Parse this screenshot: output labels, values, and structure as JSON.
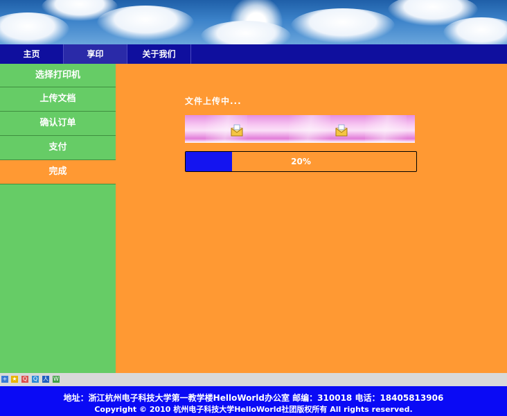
{
  "nav": {
    "items": [
      {
        "label": "主页"
      },
      {
        "label": "享印"
      },
      {
        "label": "关于我们"
      }
    ]
  },
  "sidebar": {
    "items": [
      {
        "label": "选择打印机"
      },
      {
        "label": "上传文档"
      },
      {
        "label": "确认订单"
      },
      {
        "label": "支付"
      },
      {
        "label": "完成"
      }
    ]
  },
  "main": {
    "upload_title": "文件上传中...",
    "progress": {
      "value": 0.2,
      "label": "20%"
    }
  },
  "footer": {
    "line1": "地址：浙江杭州电子科技大学第一教学楼HelloWorld办公室 邮编：310018 电话：18405813906",
    "line2": "Copyright © 2010 杭州电子科技大学HelloWorld社团版权所有 All rights reserved."
  },
  "colors": {
    "nav_bg": "#0f0f9e",
    "sidebar_bg": "#66cc66",
    "main_bg": "#ff9933",
    "progress_fill": "#1414f0",
    "footer_bg": "#0a0af5"
  },
  "share_icons": [
    "share-plus-icon",
    "favorite-star-icon",
    "qzone-icon",
    "qq-icon",
    "renren-icon",
    "wechat-icon"
  ]
}
